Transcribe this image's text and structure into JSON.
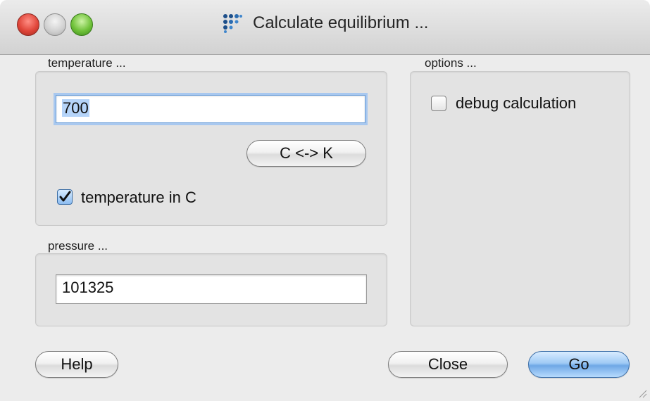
{
  "window": {
    "title": "Calculate equilibrium ..."
  },
  "temperature": {
    "group_label": "temperature ...",
    "value": "700",
    "convert_button": "C <-> K",
    "in_c_label": "temperature in C",
    "in_c_checked": true
  },
  "pressure": {
    "group_label": "pressure ...",
    "value": "101325"
  },
  "options": {
    "group_label": "options ...",
    "debug_label": "debug calculation",
    "debug_checked": false
  },
  "buttons": {
    "help": "Help",
    "close": "Close",
    "go": "Go"
  },
  "colors": {
    "focus_ring": "#a8c8ef",
    "default_button": "#6fa8e6",
    "window_bg": "#ececec"
  }
}
